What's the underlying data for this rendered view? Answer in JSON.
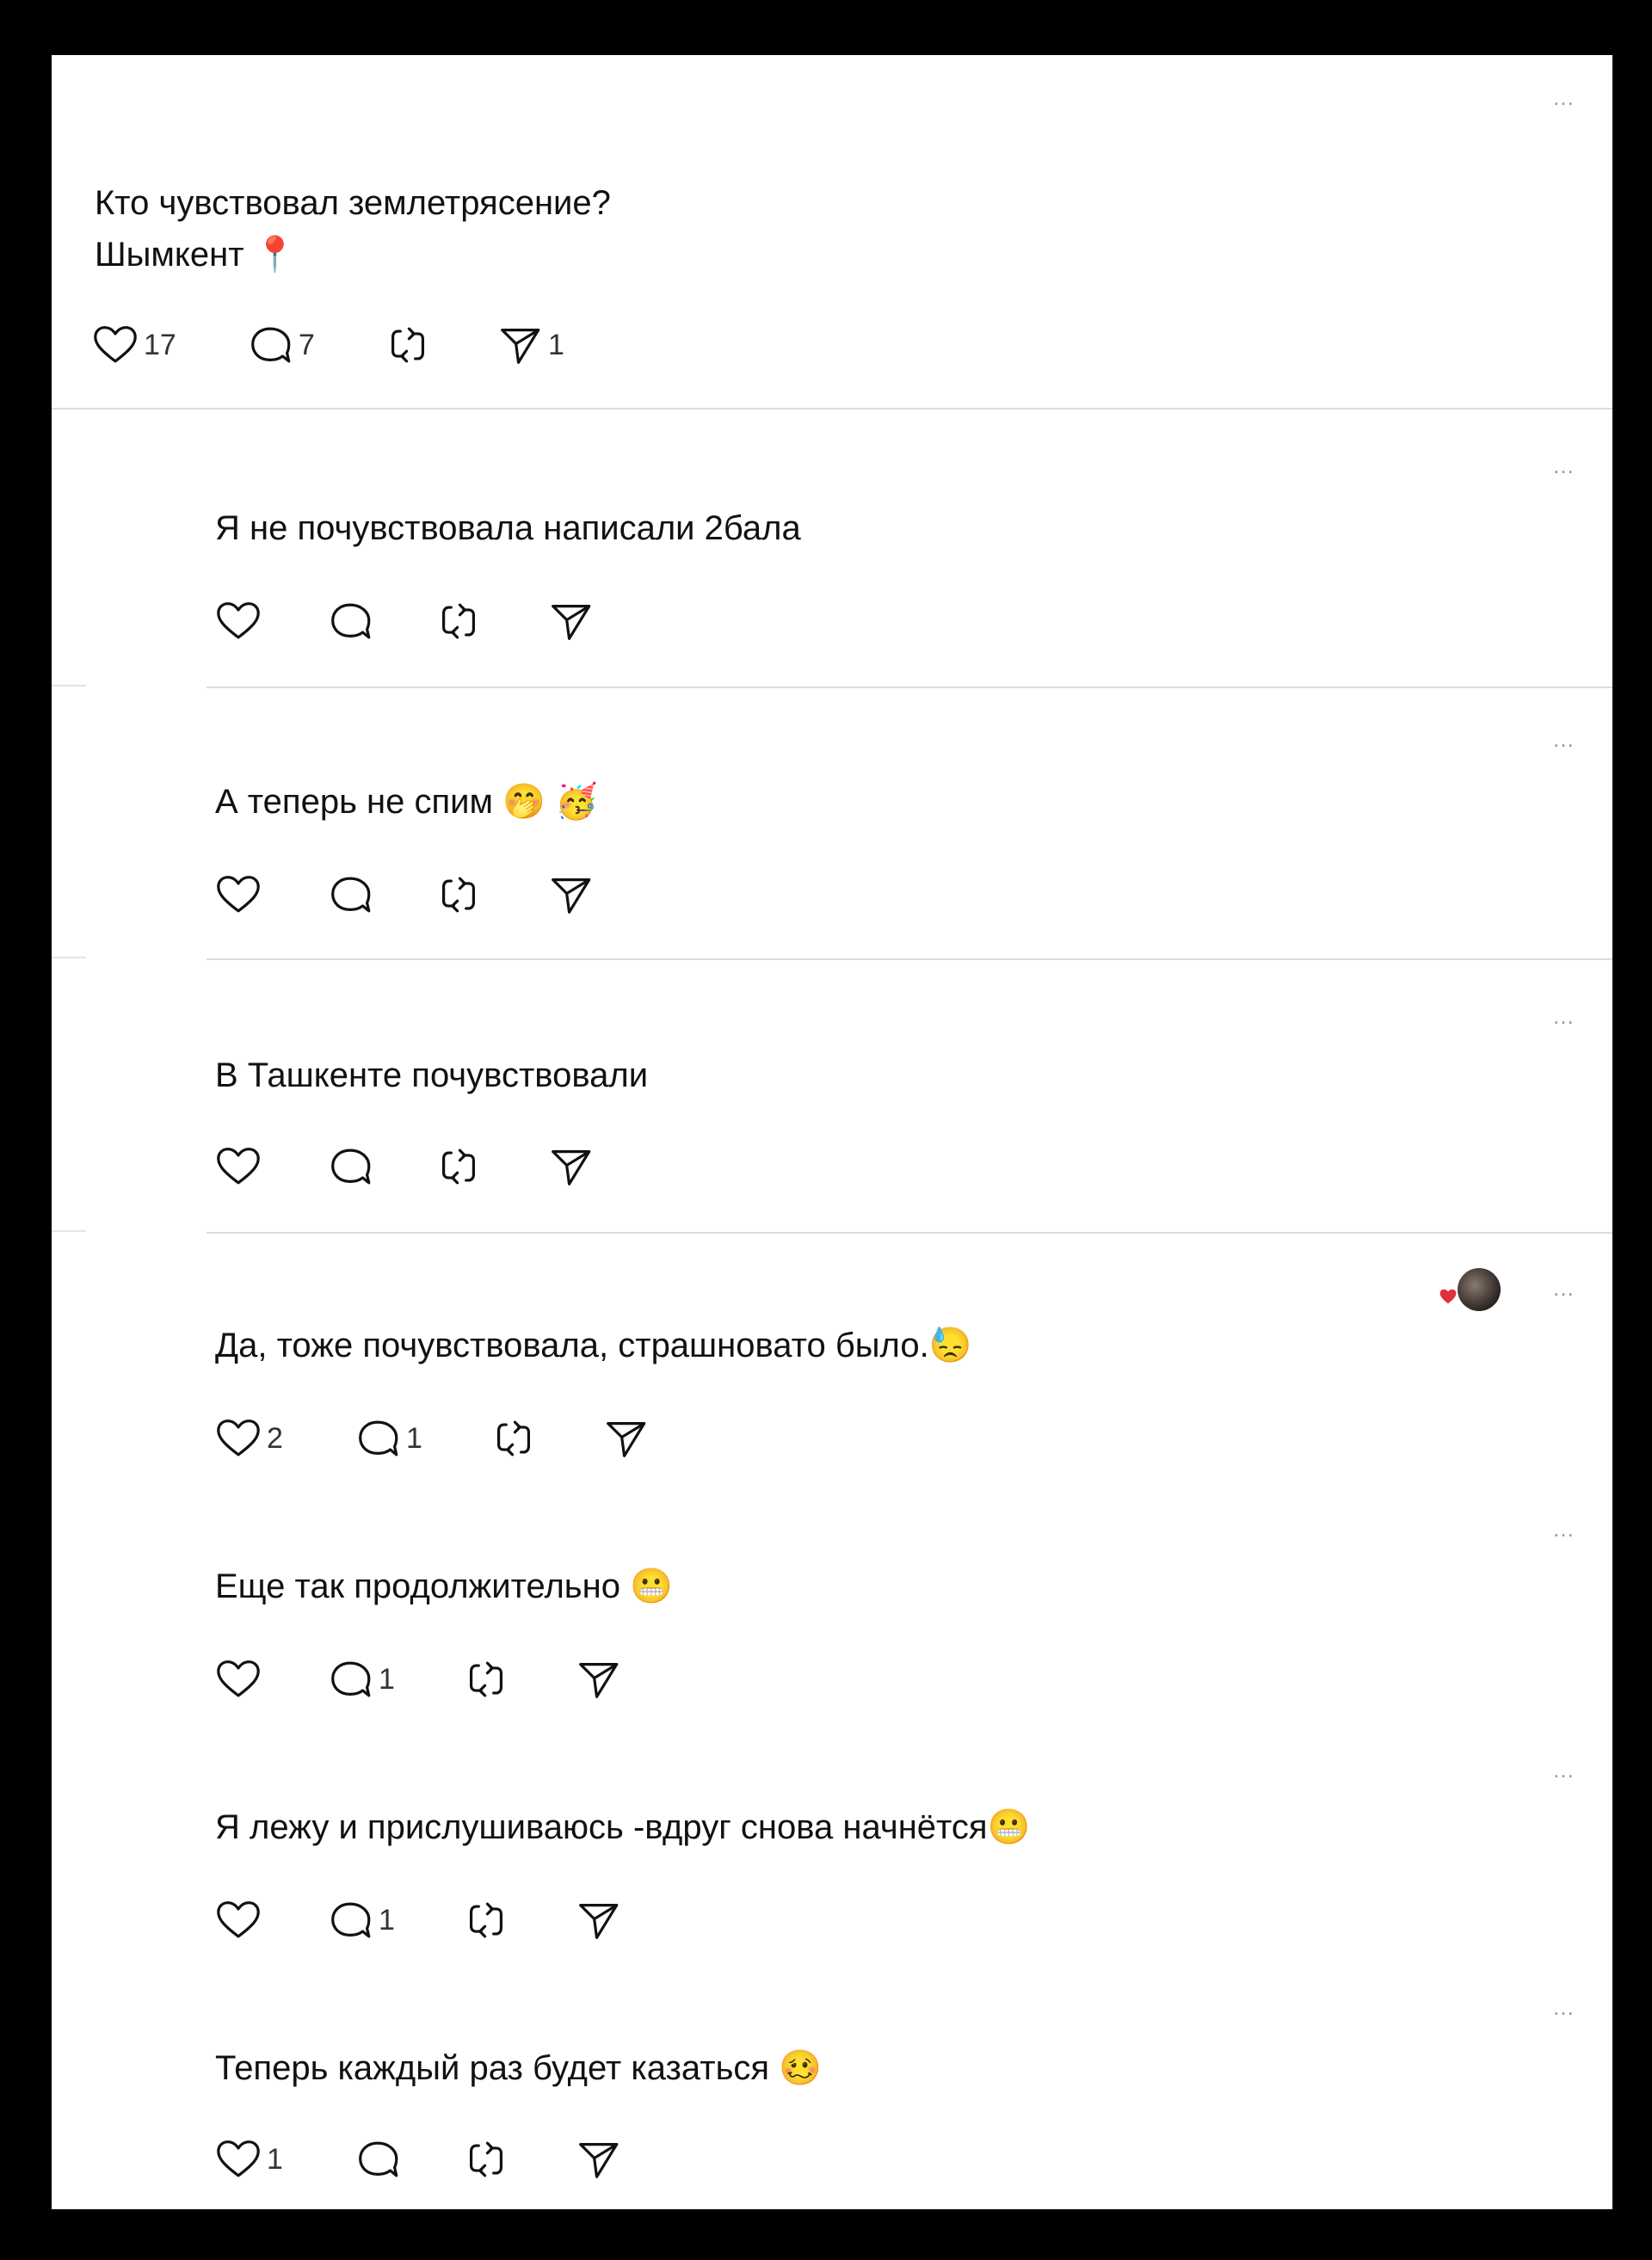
{
  "colors": {
    "page_bg": "#000000",
    "card_bg": "#ffffff",
    "divider": "#dcdcdc",
    "icon": "#111111",
    "more": "#9a9a9a",
    "heart_badge": "#e0303c"
  },
  "more_label": "…",
  "posts": [
    {
      "text": "Кто чувствовал землетрясение?\nШымкент 📍",
      "likes": "17",
      "replies": "7",
      "reposts": "",
      "shares": "1"
    },
    {
      "text": "Я не почувствовала написали 2бала",
      "likes": "",
      "replies": "",
      "reposts": "",
      "shares": ""
    },
    {
      "text": "А теперь не спим 🤭 🥳",
      "likes": "",
      "replies": "",
      "reposts": "",
      "shares": ""
    },
    {
      "text": "В Ташкенте почувствовали",
      "likes": "",
      "replies": "",
      "reposts": "",
      "shares": ""
    },
    {
      "text": "Да, тоже почувствовала, страшновато было.😓",
      "likes": "2",
      "replies": "1",
      "reposts": "",
      "shares": ""
    },
    {
      "text": "Еще так продолжительно 😬",
      "likes": "",
      "replies": "1",
      "reposts": "",
      "shares": ""
    },
    {
      "text": "Я лежу и прислушиваюсь -вдруг снова начнётся😬",
      "likes": "",
      "replies": "1",
      "reposts": "",
      "shares": ""
    },
    {
      "text": "Теперь каждый раз будет казаться 🥴",
      "likes": "1",
      "replies": "",
      "reposts": "",
      "shares": ""
    }
  ],
  "icons": {
    "like": "heart-icon",
    "reply": "comment-bubble-icon",
    "repost": "repost-icon",
    "share": "share-paper-plane-icon",
    "more": "more-dots-icon"
  }
}
